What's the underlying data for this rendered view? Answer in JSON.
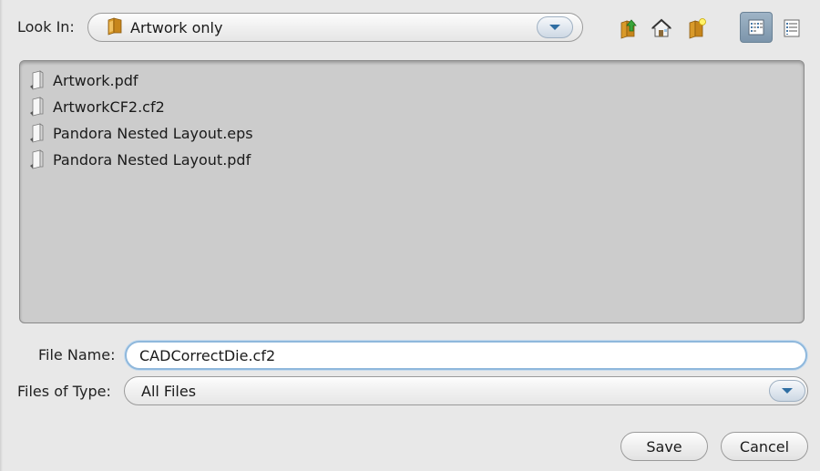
{
  "look_in": {
    "label": "Look In:",
    "value": "Artwork only"
  },
  "toolbar": {
    "up_icon": "up-folder-icon",
    "home_icon": "home-icon",
    "new_folder_icon": "new-folder-icon",
    "list_view_icon": "list-view-icon",
    "details_view_icon": "details-view-icon"
  },
  "files": [
    {
      "name": "Artwork.pdf"
    },
    {
      "name": "ArtworkCF2.cf2"
    },
    {
      "name": "Pandora Nested Layout.eps"
    },
    {
      "name": "Pandora Nested Layout.pdf"
    }
  ],
  "file_name": {
    "label": "File Name:",
    "value": "CADCorrectDie.cf2"
  },
  "files_of_type": {
    "label": "Files of Type:",
    "value": "All Files"
  },
  "buttons": {
    "save": "Save",
    "cancel": "Cancel"
  },
  "colors": {
    "background": "#e8e8e8",
    "list_background": "#cccccc",
    "focus_ring": "#8fb8dc",
    "arrow": "#2f6ea3"
  }
}
